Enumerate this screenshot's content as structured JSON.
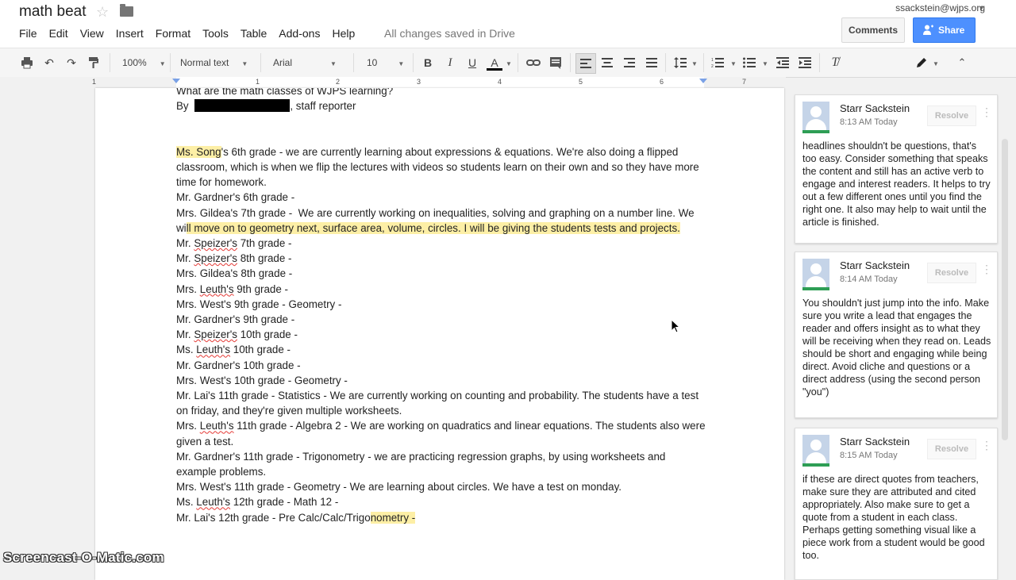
{
  "header": {
    "doc_title": "math beat",
    "menu": [
      "File",
      "Edit",
      "View",
      "Insert",
      "Format",
      "Tools",
      "Table",
      "Add-ons",
      "Help"
    ],
    "save_status": "All changes saved in Drive",
    "account": "ssackstein@wjps.org",
    "comments_label": "Comments",
    "share_label": "Share"
  },
  "toolbar": {
    "zoom": "100%",
    "style": "Normal text",
    "font": "Arial",
    "size": "10",
    "bold": "B",
    "italic": "I",
    "underline": "U",
    "textcolor": "A"
  },
  "ruler": {
    "ticks": [
      "1",
      "1",
      "2",
      "3",
      "4",
      "5",
      "6",
      "7"
    ]
  },
  "document": {
    "line0": "What are the math classes of WJPS learning?",
    "line1_by": "By ",
    "line1_after": ", staff reporter",
    "p_song_a": "Ms. Song",
    "p_song_b": "'s 6th grade - we are currently learning about expressions & equations. We're also doing a flipped classroom, which is when we flip the lectures with videos so students learn on their own and so they have more time for homework.",
    "l_gardner6": "Mr. Gardner's 6th grade -",
    "p_gildea7_a": "Mrs. Gildea's 7th grade -  We are currently working on inequalities, solving and graphing on a number line. We wi",
    "p_gildea7_b": "ll move on to geometry next, surface area, volume, circles. I will be giving the students tests and projects.",
    "speizer": "Speizer's",
    "leuth": "Leuth's",
    "l_speizer7_a": "Mr. ",
    "l_speizer7_b": " 7th grade -",
    "l_speizer8_a": "Mr. ",
    "l_speizer8_b": " 8th grade -",
    "l_gildea8": "Mrs. Gildea's 8th grade -",
    "l_leuth9_a": "Mrs. ",
    "l_leuth9_b": " 9th grade -",
    "l_west9": "Mrs. West's 9th grade - Geometry -",
    "l_gardner9": "Mr. Gardner's 9th grade -",
    "l_speizer10_a": "Mr. ",
    "l_speizer10_b": " 10th grade -",
    "l_leuth10_a": "Ms. ",
    "l_leuth10_b": " 10th grade -",
    "l_gardner10": "Mr. Gardner's 10th grade -",
    "l_west10": "Mrs. West's 10th grade - Geometry -",
    "p_lai11": "Mr. Lai's 11th grade - Statistics - We are currently working on counting and probability. The students have a test on friday, and they're given multiple worksheets.",
    "p_leuth11_a": "Mrs. ",
    "p_leuth11_b": " 11th grade - Algebra 2 - We are working on quadratics and linear equations. The students also were given a test.",
    "p_gardner11": "Mr. Gardner's 11th grade - Trigonometry - we are practicing regression graphs, by using worksheets and example problems.",
    "p_west11": "Mrs. West's 11th grade - Geometry - We are learning about circles. We have a test on monday.",
    "l_leuth12_a": "Ms. ",
    "l_leuth12_b": " 12th grade - Math 12 -",
    "l_lai12_a": "Mr. Lai's 12th grade - Pre Calc/Calc/Trigo",
    "l_lai12_b": "nometry -"
  },
  "comments": [
    {
      "author": "Starr Sackstein",
      "time": "8:13 AM Today",
      "resolve": "Resolve",
      "text": "headlines shouldn't be questions, that's too easy. Consider something that speaks the content and still has an active verb to engage and interest readers. It helps to try out a few different ones until you find the right one. It also may help to wait until the article is finished."
    },
    {
      "author": "Starr Sackstein",
      "time": "8:14 AM Today",
      "resolve": "Resolve",
      "text": "You shouldn't just jump into the info. Make sure you write a lead that engages the reader and offers insight as to what they will be receiving when they read on. Leads should be short and engaging while being direct. Avoid cliche and questions or a direct address (using the second person \"you\")"
    },
    {
      "author": "Starr Sackstein",
      "time": "8:15 AM Today",
      "resolve": "Resolve",
      "text": "if these are direct quotes from teachers, make sure they are attributed and cited appropriately. Also make sure to get a quote from a student in each class. Perhaps getting something visual like a piece work from a student would be good too."
    }
  ],
  "watermark": "Screencast-O-Matic.com",
  "icons": [
    "star-icon",
    "folder-icon",
    "print-icon",
    "undo-icon",
    "redo-icon",
    "paint-format-icon",
    "link-icon",
    "comment-icon",
    "align-left-icon",
    "align-center-icon",
    "align-right-icon",
    "justify-icon",
    "line-spacing-icon",
    "numbered-list-icon",
    "bulleted-list-icon",
    "decrease-indent-icon",
    "increase-indent-icon",
    "clear-formatting-icon",
    "pen-icon",
    "collapse-icon",
    "mouse-cursor-icon"
  ]
}
